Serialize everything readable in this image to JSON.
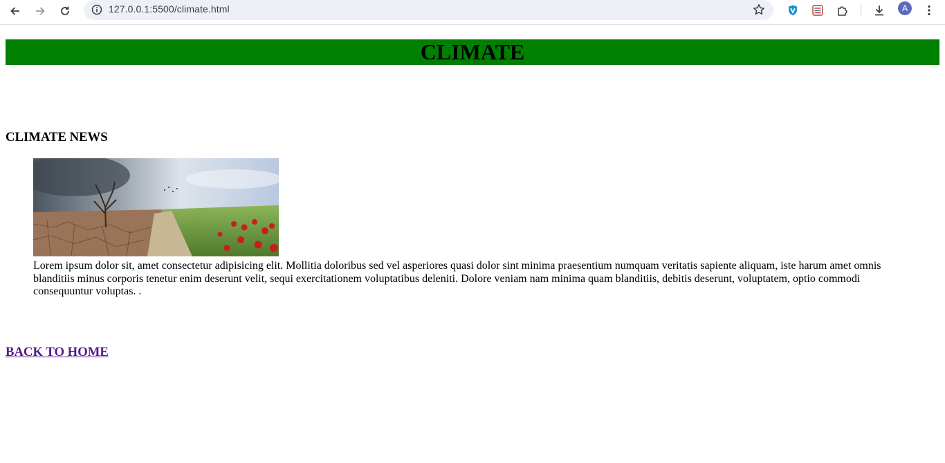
{
  "browser": {
    "url": "127.0.0.1:5500/climate.html",
    "profile_initial": "A",
    "icons": [
      "back-icon",
      "forward-icon",
      "reload-icon",
      "site-info-icon",
      "bookmark-star-icon",
      "shield-extension-icon",
      "reader-extension-icon",
      "extensions-puzzle-icon",
      "download-icon",
      "menu-dots-icon"
    ]
  },
  "page": {
    "title": "CLIMATE",
    "banner_color": "#008000",
    "news_heading": "CLIMATE NEWS",
    "news_text": "Lorem ipsum dolor sit, amet consectetur adipisicing elit. Mollitia doloribus sed vel asperiores quasi dolor sint minima praesentium numquam veritatis sapiente aliquam, iste harum amet omnis blanditiis minus corporis tenetur enim deserunt velit, sequi exercitationem voluptatibus deleniti. Dolore veniam nam minima quam blanditiis, debitis deserunt, voluptatem, optio commodi consequuntur voluptas. .",
    "back_link": "BACK TO HOME",
    "link_color": "#551a8b"
  }
}
